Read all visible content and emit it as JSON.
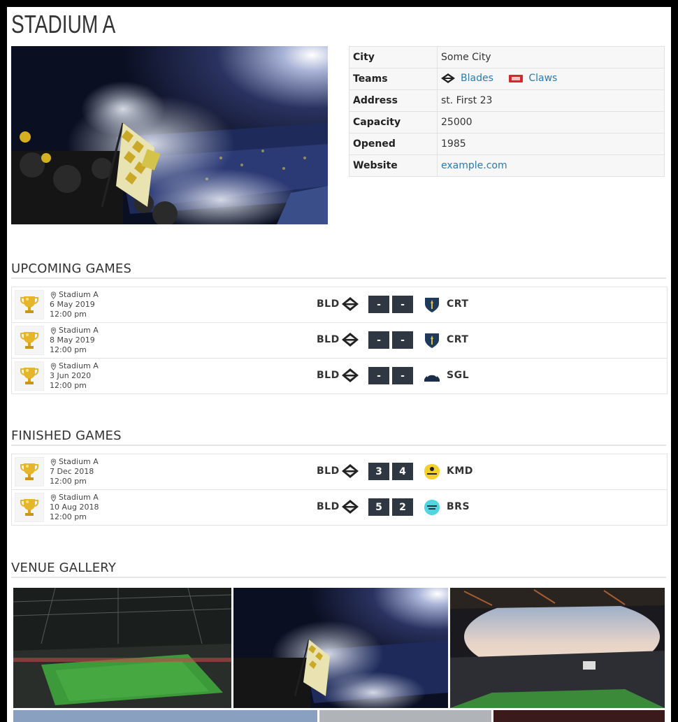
{
  "page_title": "STADIUM A",
  "info": {
    "city_label": "City",
    "city_value": "Some City",
    "teams_label": "Teams",
    "teams": [
      {
        "name": "Blades",
        "icon": "diamond-badge-icon"
      },
      {
        "name": "Claws",
        "icon": "red-claw-icon"
      }
    ],
    "address_label": "Address",
    "address_value": "st. First 23",
    "capacity_label": "Capacity",
    "capacity_value": "25000",
    "opened_label": "Opened",
    "opened_value": "1985",
    "website_label": "Website",
    "website_value": "example.com"
  },
  "upcoming": {
    "heading": "UPCOMING GAMES",
    "games": [
      {
        "venue": "Stadium A",
        "date": "6 May 2019",
        "time": "12:00 pm",
        "home": "BLD",
        "score_home": "-",
        "score_away": "-",
        "away": "CRT",
        "away_icon": "shield-icon"
      },
      {
        "venue": "Stadium A",
        "date": "8 May 2019",
        "time": "12:00 pm",
        "home": "BLD",
        "score_home": "-",
        "score_away": "-",
        "away": "CRT",
        "away_icon": "shield-icon"
      },
      {
        "venue": "Stadium A",
        "date": "3 Jun 2020",
        "time": "12:00 pm",
        "home": "BLD",
        "score_home": "-",
        "score_away": "-",
        "away": "SGL",
        "away_icon": "eagle-icon"
      }
    ]
  },
  "finished": {
    "heading": "FINISHED GAMES",
    "games": [
      {
        "venue": "Stadium A",
        "date": "7 Dec 2018",
        "time": "12:00 pm",
        "home": "BLD",
        "score_home": "3",
        "score_away": "4",
        "away": "KMD",
        "away_icon": "yellow-blob-icon"
      },
      {
        "venue": "Stadium A",
        "date": "10 Aug 2018",
        "time": "12:00 pm",
        "home": "BLD",
        "score_home": "5",
        "score_away": "2",
        "away": "BRS",
        "away_icon": "cyan-blob-icon"
      }
    ]
  },
  "gallery": {
    "heading": "VENUE GALLERY"
  },
  "colors": {
    "link": "#2a7ab0",
    "score_bg": "#2f3742",
    "table_bg": "#f7f7f7"
  }
}
